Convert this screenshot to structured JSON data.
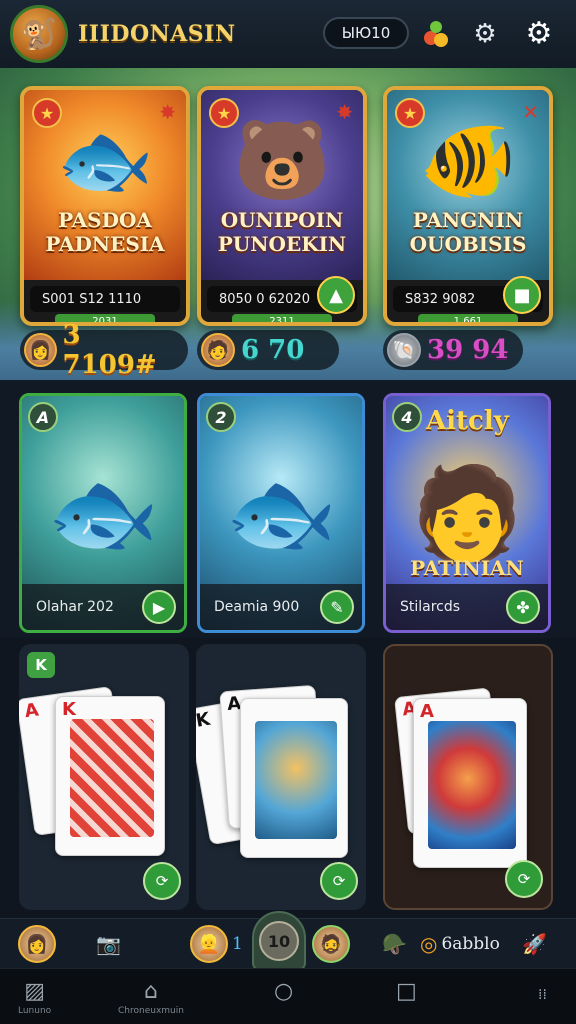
{
  "header": {
    "brand": "IIIDONASIN",
    "balance": "ЫЮ10",
    "icons": {
      "logo": "monkey-logo",
      "gems": "gems-icon",
      "gear": "gear-icon",
      "settings": "settings-icon"
    }
  },
  "featured": [
    {
      "title": "PASDOA PADNESIA",
      "stats": "S001 S12   1110",
      "tag": "2031",
      "icon": "fish-icon"
    },
    {
      "title": "OUNIPOIN PUNOEKIN",
      "stats": "8050 0 62020",
      "tag": "2311",
      "icon": "bear-icon"
    },
    {
      "title": "PANGNIN OUOBISIS",
      "stats": "S832 9082",
      "tag": "1.661",
      "icon": "fish-icon"
    }
  ],
  "coins": [
    {
      "value": "3 7109#",
      "icon": "coin-icon"
    },
    {
      "value": "6 70",
      "icon": "coin-icon"
    },
    {
      "value": "39 94",
      "icon": "coin-icon"
    }
  ],
  "middle": [
    {
      "badge": "A",
      "label": "Olahar 202",
      "icon": "fish-icon"
    },
    {
      "badge": "2",
      "label": "Deamia 900",
      "icon": "fish-icon"
    },
    {
      "badge": "4",
      "headline": "Aitcly",
      "banner": "PATINIAN",
      "label": "Stilarcds",
      "icon": "character-icon"
    }
  ],
  "games": [
    {
      "badge": "K",
      "card1": "A",
      "card2": "K",
      "icon": "cards-icon"
    },
    {
      "badge": "",
      "card1": "K",
      "card2": "A",
      "icon": "cards-icon"
    },
    {
      "badge": "",
      "card1": "A",
      "card2": "A",
      "icon": "cards-icon"
    }
  ],
  "playerbar": {
    "center_number": "10",
    "mid_number": "1",
    "right_text": "6abblo"
  },
  "navbar": {
    "left_caption": "Lununo",
    "home_caption": "Chroneuxmuin"
  },
  "colors": {
    "accent": "#3fae42",
    "gold": "#e0a83a",
    "background": "#0f1620"
  }
}
